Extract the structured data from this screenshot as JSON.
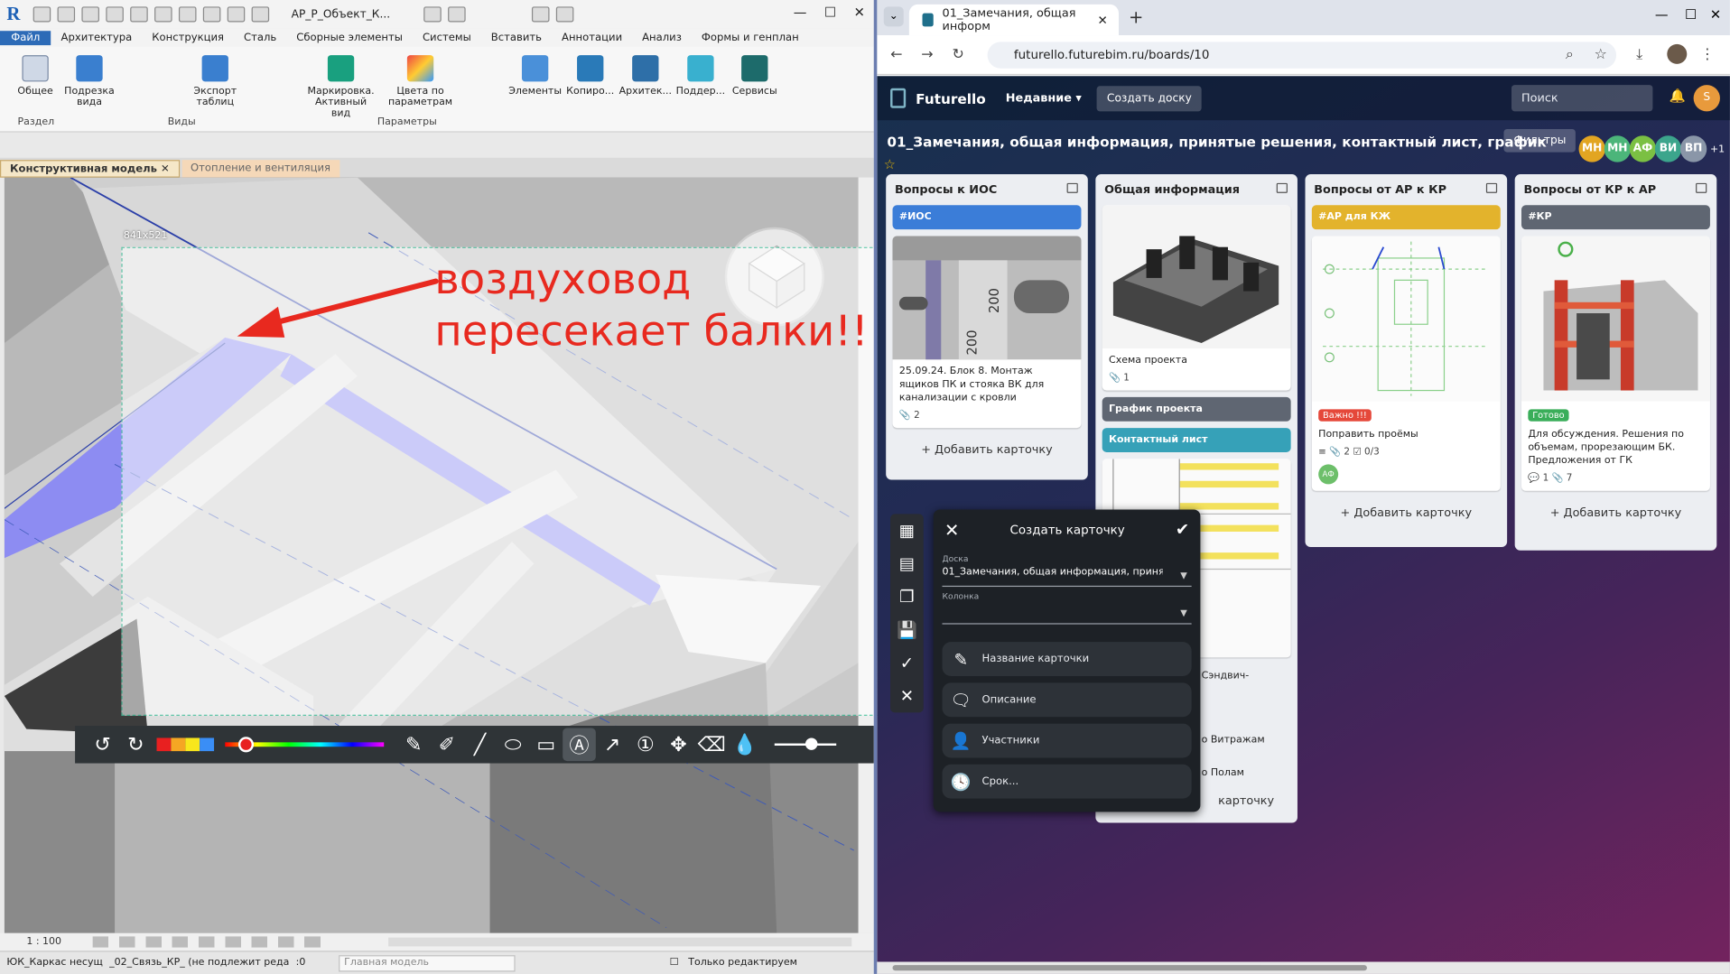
{
  "revit": {
    "file_title": "AP_P_Объект_К...",
    "menu": [
      "Файл",
      "Архитектура",
      "Конструкция",
      "Сталь",
      "Сборные элементы",
      "Системы",
      "Вставить",
      "Аннотации",
      "Анализ",
      "Формы и генплан"
    ],
    "ribbon": {
      "general": "Общее",
      "crop_view": "Подрезка вида",
      "export_tables": "Экспорт таблиц",
      "marking": "Маркировка. Активный вид",
      "colors_by_params": "Цвета по параметрам",
      "elements": "Элементы",
      "copy": "Копиро...",
      "architect": "Архитек...",
      "support": "Поддер...",
      "services": "Сервисы",
      "group_section": "Раздел",
      "group_views": "Виды",
      "group_params": "Параметры"
    },
    "view_tabs": [
      "Конструктивная модель",
      "Отопление и вентиляция"
    ],
    "annotation": {
      "line1": "воздуховод",
      "line2": "пересекает балки!!",
      "dim": "841x521"
    },
    "scale": "1 : 100",
    "status_left": "ЮК_Каркас несущ",
    "status_link": "_02_Связь_КР_ (не подлежит реда",
    "status_zero": ":0",
    "status_model": "Главная модель",
    "status_edit_only": "Только редактируем"
  },
  "browser": {
    "tab_title": "01_Замечания, общая информ",
    "url": "futurello.futurebim.ru/boards/10"
  },
  "app": {
    "name": "Futurello",
    "recent": "Недавние",
    "create_board": "Создать доску",
    "search_placeholder": "Поиск",
    "me": "S",
    "board_title": "01_Замечания, общая информация, принятые решения, контактный лист, график",
    "filters": "Фильтры",
    "avatars": [
      "МН",
      "МН",
      "АФ",
      "ВИ",
      "ВП"
    ],
    "more_members": "+1",
    "add_card": "+ Добавить карточку",
    "columns": [
      {
        "title": "Вопросы к ИОС",
        "tag": "#ИОС",
        "card_text": "25.09.24. Блок 8. Монтаж ящиков ПК и стояка ВК для канализации с кровли",
        "attachments": "2"
      },
      {
        "title": "Общая информация",
        "card1_text": "Схема проекта",
        "card1_attachments": "1",
        "card2": "График проекта",
        "card3": "Контактный лист",
        "peek1": "Сэндвич-",
        "peek2": "о Витражам",
        "peek3": "о Полам",
        "add_partial": "карточку"
      },
      {
        "title": "Вопросы от АР к КР",
        "tag": "#АР для КЖ",
        "badge": "Важно !!!",
        "card_text": "Поправить проёмы",
        "meta": "2",
        "checklist": "0/3",
        "avatar": "АФ"
      },
      {
        "title": "Вопросы от КР к АР",
        "tag": "#КР",
        "badge": "Готово",
        "card_text": "Для обсуждения. Решения по объемам, прорезающим БК. Предложения от ГК",
        "comments": "1",
        "attachments": "7"
      }
    ],
    "modal": {
      "title": "Создать карточку",
      "board_label": "Доска",
      "board_value": "01_Замечания, общая информация, принят",
      "column_label": "Колонка",
      "options": [
        "Название карточки",
        "Описание",
        "Участники",
        "Срок..."
      ]
    }
  }
}
